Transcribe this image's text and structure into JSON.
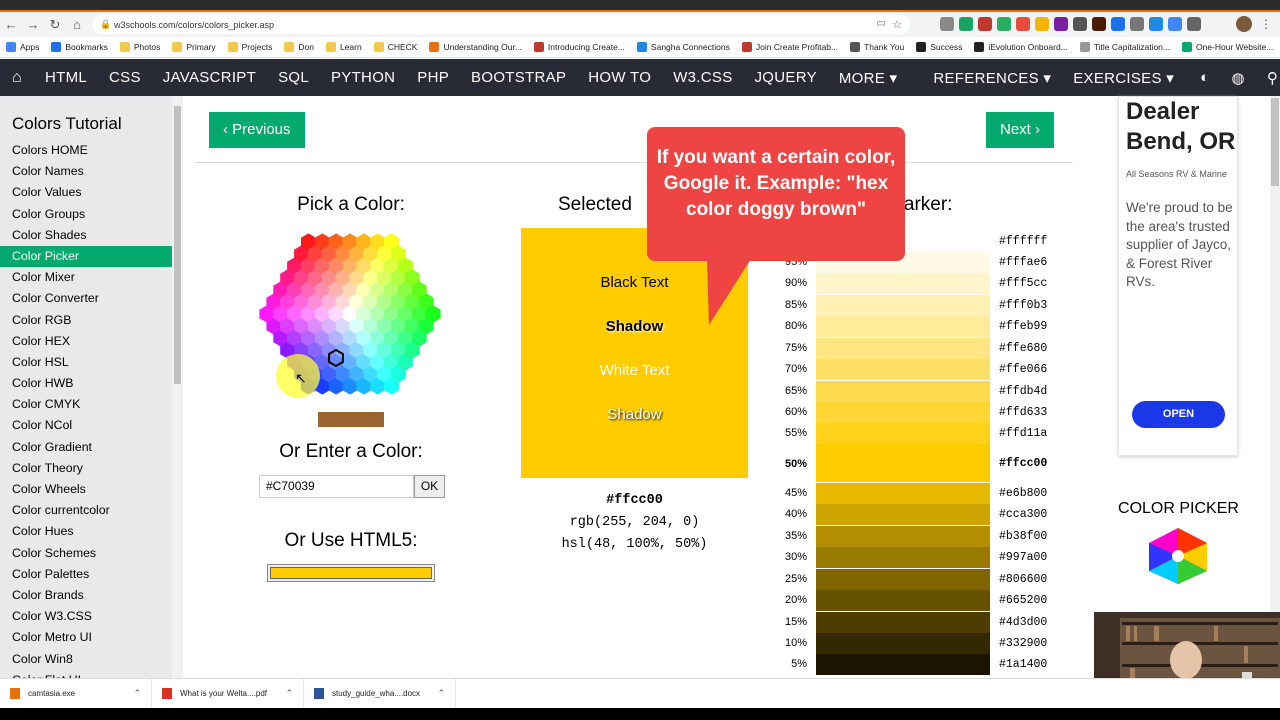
{
  "browser": {
    "url": "w3schools.com/colors/colors_picker.asp",
    "bookmarks": [
      "Apps",
      "Bookmarks",
      "Photos",
      "Primary",
      "Projects",
      "Don",
      "Learn",
      "CHECK",
      "Understanding Our...",
      "Introducing Create...",
      "Sangha Connections",
      "Join Create Profitab...",
      "Thank You",
      "Success",
      "iEvolution Onboard...",
      "Title Capitalization...",
      "One-Hour Website..."
    ]
  },
  "nav": {
    "items": [
      "HTML",
      "CSS",
      "JAVASCRIPT",
      "SQL",
      "PYTHON",
      "PHP",
      "BOOTSTRAP",
      "HOW TO",
      "W3.CSS",
      "JQUERY",
      "MORE ▾",
      "REFERENCES ▾",
      "EXERCISES ▾"
    ]
  },
  "sidebar": {
    "title": "Colors Tutorial",
    "items": [
      "Colors HOME",
      "Color Names",
      "Color Values",
      "Color Groups",
      "Color Shades",
      "Color Picker",
      "Color Mixer",
      "Color Converter",
      "Color RGB",
      "Color HEX",
      "Color HSL",
      "Color HWB",
      "Color CMYK",
      "Color NCol",
      "Color Gradient",
      "Color Theory",
      "Color Wheels",
      "Color currentcolor",
      "Color Hues",
      "Color Schemes",
      "Color Palettes",
      "Color Brands",
      "Color W3.CSS",
      "Color Metro UI",
      "Color Win8",
      "Color Flat UI"
    ],
    "active_index": 5
  },
  "main": {
    "prev": "‹ Previous",
    "next": "Next ›",
    "pick_heading": "Pick a Color:",
    "enter_heading": "Or Enter a Color:",
    "input_value": "#C70039",
    "ok_label": "OK",
    "html5_heading": "Or Use HTML5:",
    "selected_heading": "Selected",
    "lighter_heading": "r / Darker:",
    "preview": {
      "color": "#ffcc00",
      "black_text": "Black Text",
      "shadow1": "Shadow",
      "white_text": "White Text",
      "shadow2": "Shadow"
    },
    "codes": {
      "hex": "#ffcc00",
      "rgb": "rgb(255, 204, 0)",
      "hsl": "hsl(48, 100%, 50%)"
    },
    "shades": [
      {
        "pct": "",
        "hex": "#ffffff"
      },
      {
        "pct": "95%",
        "hex": "#fffae6"
      },
      {
        "pct": "90%",
        "hex": "#fff5cc"
      },
      {
        "pct": "85%",
        "hex": "#fff0b3"
      },
      {
        "pct": "80%",
        "hex": "#ffeb99"
      },
      {
        "pct": "75%",
        "hex": "#ffe680"
      },
      {
        "pct": "70%",
        "hex": "#ffe066"
      },
      {
        "pct": "65%",
        "hex": "#ffdb4d"
      },
      {
        "pct": "60%",
        "hex": "#ffd633"
      },
      {
        "pct": "55%",
        "hex": "#ffd11a"
      },
      {
        "pct": "50%",
        "hex": "#ffcc00"
      },
      {
        "pct": "45%",
        "hex": "#e6b800"
      },
      {
        "pct": "40%",
        "hex": "#cca300"
      },
      {
        "pct": "35%",
        "hex": "#b38f00"
      },
      {
        "pct": "30%",
        "hex": "#997a00"
      },
      {
        "pct": "25%",
        "hex": "#806600"
      },
      {
        "pct": "20%",
        "hex": "#665200"
      },
      {
        "pct": "15%",
        "hex": "#4d3d00"
      },
      {
        "pct": "10%",
        "hex": "#332900"
      },
      {
        "pct": "5%",
        "hex": "#1a1400"
      }
    ]
  },
  "callout": {
    "text": "If you want a certain color, Google it. Example: \"hex color doggy brown\""
  },
  "ad": {
    "title": "Dealer Bend, OR",
    "subtitle": "All Seasons RV & Marine",
    "body": "We're proud to be the area's trusted supplier of Jayco, & Forest River RVs.",
    "open": "OPEN",
    "picker_label": "COLOR PICKER"
  },
  "downloads": [
    "camtasia.exe",
    "What is your Welta....pdf",
    "study_guide_wha....docx"
  ],
  "colors": {
    "w3green": "#04aa6d",
    "navbar": "#282a35",
    "callout": "#ee4444",
    "selected": "#ffcc00"
  }
}
